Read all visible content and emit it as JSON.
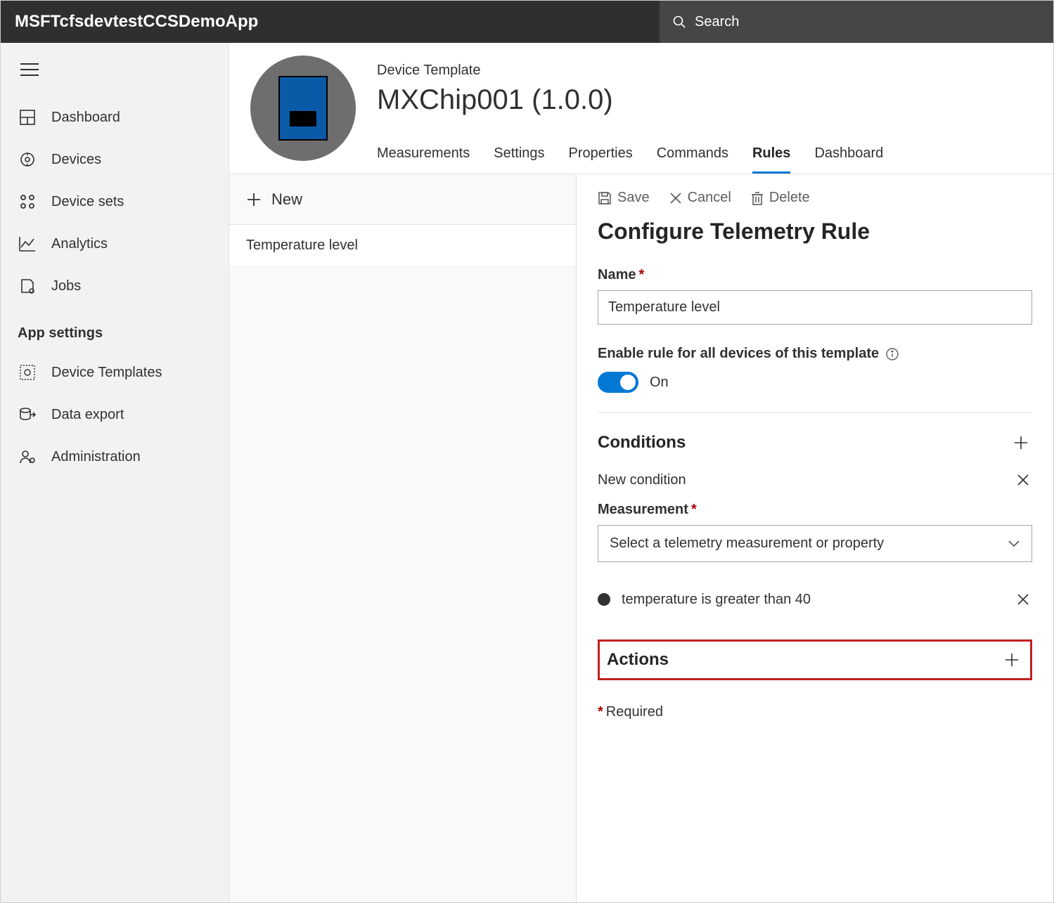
{
  "topbar": {
    "app_title": "MSFTcfsdevtestCCSDemoApp",
    "search_placeholder": "Search"
  },
  "sidebar": {
    "items": [
      {
        "label": "Dashboard"
      },
      {
        "label": "Devices"
      },
      {
        "label": "Device sets"
      },
      {
        "label": "Analytics"
      },
      {
        "label": "Jobs"
      }
    ],
    "section_header": "App settings",
    "settings_items": [
      {
        "label": "Device Templates"
      },
      {
        "label": "Data export"
      },
      {
        "label": "Administration"
      }
    ]
  },
  "template": {
    "label": "Device Template",
    "title": "MXChip001  (1.0.0)",
    "tabs": [
      {
        "label": "Measurements"
      },
      {
        "label": "Settings"
      },
      {
        "label": "Properties"
      },
      {
        "label": "Commands"
      },
      {
        "label": "Rules",
        "active": true
      },
      {
        "label": "Dashboard"
      }
    ]
  },
  "rules_list": {
    "new_label": "New",
    "items": [
      {
        "label": "Temperature level"
      }
    ]
  },
  "detail": {
    "toolbar": {
      "save": "Save",
      "cancel": "Cancel",
      "delete": "Delete"
    },
    "title": "Configure Telemetry Rule",
    "name_label": "Name",
    "name_value": "Temperature level",
    "enable_label": "Enable rule for all devices of this template",
    "toggle_state": "On",
    "conditions": {
      "heading": "Conditions",
      "new_condition_label": "New condition",
      "measurement_label": "Measurement",
      "measurement_placeholder": "Select a telemetry measurement or property",
      "existing_condition_text": "temperature is greater than 40"
    },
    "actions": {
      "heading": "Actions"
    },
    "required_note": "Required"
  }
}
